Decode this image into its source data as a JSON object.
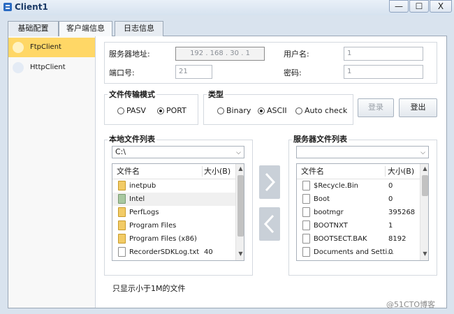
{
  "window": {
    "title": "Client1",
    "min_label": "—",
    "max_label": "☐",
    "close_label": "X"
  },
  "tabs": [
    {
      "label": "基础配置"
    },
    {
      "label": "客户端信息"
    },
    {
      "label": "日志信息"
    }
  ],
  "nav": [
    {
      "label": "FtpClient"
    },
    {
      "label": "HttpClient"
    }
  ],
  "server": {
    "address_label": "服务器地址:",
    "address_value": "192 . 168 . 30 . 1",
    "port_label": "端口号:",
    "port_value": "21",
    "username_label": "用户名:",
    "username_value": "1",
    "password_label": "密码:",
    "password_value": "1"
  },
  "transfer_mode": {
    "title": "文件传输模式",
    "options": [
      "PASV",
      "PORT"
    ],
    "selected": "PORT"
  },
  "type": {
    "title": "类型",
    "options": [
      "Binary",
      "ASCII",
      "Auto check"
    ],
    "selected": "ASCII"
  },
  "buttons": {
    "login": "登录",
    "logout": "登出"
  },
  "local": {
    "title": "本地文件列表",
    "path": "C:\\",
    "headers": {
      "name": "文件名",
      "size": "大小(B)"
    },
    "files": [
      {
        "name": "inetpub",
        "size": "",
        "icon": "folder"
      },
      {
        "name": "Intel",
        "size": "",
        "icon": "folder-green"
      },
      {
        "name": "PerfLogs",
        "size": "",
        "icon": "folder"
      },
      {
        "name": "Program Files",
        "size": "",
        "icon": "folder"
      },
      {
        "name": "Program Files (x86)",
        "size": "",
        "icon": "folder"
      },
      {
        "name": "RecorderSDKLog.txt",
        "size": "40",
        "icon": "file"
      }
    ]
  },
  "remote": {
    "title": "服务器文件列表",
    "path": "",
    "headers": {
      "name": "文件名",
      "size": "大小(B)"
    },
    "files": [
      {
        "name": "$Recycle.Bin",
        "size": "0",
        "icon": "file"
      },
      {
        "name": "Boot",
        "size": "0",
        "icon": "file"
      },
      {
        "name": "bootmgr",
        "size": "395268",
        "icon": "file"
      },
      {
        "name": "BOOTNXT",
        "size": "1",
        "icon": "file"
      },
      {
        "name": "BOOTSECT.BAK",
        "size": "8192",
        "icon": "file"
      },
      {
        "name": "Documents and Setti...",
        "size": "0",
        "icon": "file"
      }
    ]
  },
  "note": "只显示小于1M的文件",
  "watermark": "@51CTO博客"
}
